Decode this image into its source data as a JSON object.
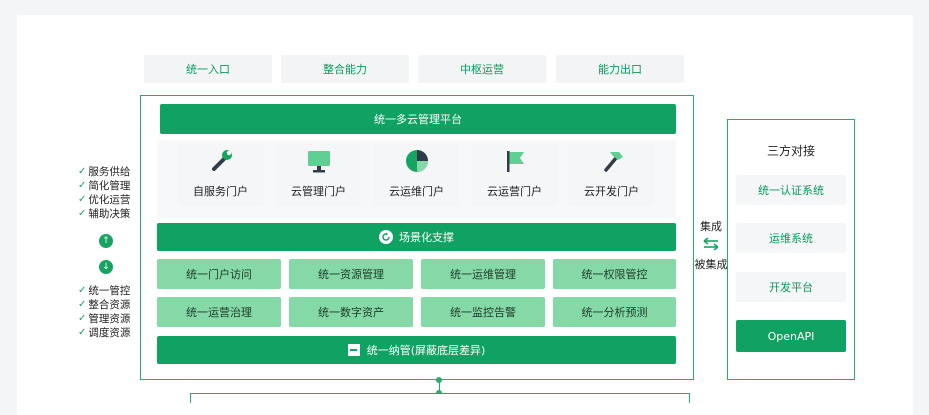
{
  "top_caps": [
    "统一入口",
    "整合能力",
    "中枢运营",
    "能力出口"
  ],
  "platform_title": "统一多云管理平台",
  "portals": [
    {
      "label": "自服务门户",
      "icon": "wrench-icon"
    },
    {
      "label": "云管理门户",
      "icon": "monitor-icon"
    },
    {
      "label": "云运维门户",
      "icon": "pie-chart-icon"
    },
    {
      "label": "云运营门户",
      "icon": "flag-icon"
    },
    {
      "label": "云开发门户",
      "icon": "hammer-icon"
    }
  ],
  "scene_support": "场景化支撑",
  "grid": [
    "统一门户访问",
    "统一资源管理",
    "统一运维管理",
    "统一权限管控",
    "统一运营治理",
    "统一数字资产",
    "统一监控告警",
    "统一分析预测"
  ],
  "bottom_bar": "统一纳管(屏蔽底层差异)",
  "left_top": [
    "服务供给",
    "简化管理",
    "优化运营",
    "辅助决策"
  ],
  "left_bottom": [
    "统一管控",
    "整合资源",
    "管理资源",
    "调度资源"
  ],
  "link_top": "集成",
  "link_bottom": "被集成",
  "third_party": {
    "title": "三方对接",
    "items": [
      "统一认证系统",
      "运维系统",
      "开发平台",
      "OpenAPI"
    ]
  },
  "colors": {
    "primary": "#0fa262",
    "light": "#85d9a6",
    "border": "#24b06c"
  }
}
